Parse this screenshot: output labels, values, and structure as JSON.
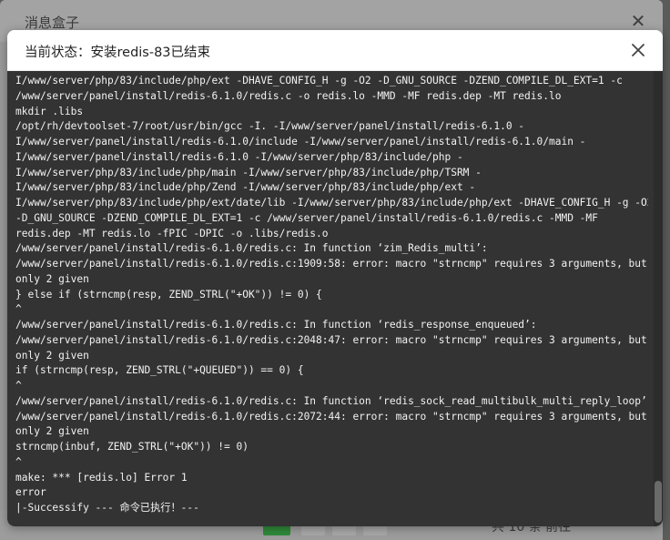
{
  "background_window": {
    "title": "消息盒子",
    "pagination": {
      "partial_text_right": "共 10 条 前往"
    }
  },
  "dialog": {
    "title": "当前状态：安装redis-83已结束",
    "close_icon": "close-icon"
  },
  "console": {
    "lines": [
      "I/www/server/php/83/include/php/ext -DHAVE_CONFIG_H -g -O2 -D_GNU_SOURCE -DZEND_COMPILE_DL_EXT=1 -c",
      "/www/server/panel/install/redis-6.1.0/redis.c -o redis.lo -MMD -MF redis.dep -MT redis.lo",
      "mkdir .libs",
      "/opt/rh/devtoolset-7/root/usr/bin/gcc -I. -I/www/server/panel/install/redis-6.1.0 -",
      "I/www/server/panel/install/redis-6.1.0/include -I/www/server/panel/install/redis-6.1.0/main -",
      "I/www/server/panel/install/redis-6.1.0 -I/www/server/php/83/include/php -",
      "I/www/server/php/83/include/php/main -I/www/server/php/83/include/php/TSRM -",
      "I/www/server/php/83/include/php/Zend -I/www/server/php/83/include/php/ext -",
      "I/www/server/php/83/include/php/ext/date/lib -I/www/server/php/83/include/php/ext -DHAVE_CONFIG_H -g -O2",
      "-D_GNU_SOURCE -DZEND_COMPILE_DL_EXT=1 -c /www/server/panel/install/redis-6.1.0/redis.c -MMD -MF",
      "redis.dep -MT redis.lo -fPIC -DPIC -o .libs/redis.o",
      "/www/server/panel/install/redis-6.1.0/redis.c: In function ‘zim_Redis_multi’:",
      "/www/server/panel/install/redis-6.1.0/redis.c:1909:58: error: macro \"strncmp\" requires 3 arguments, but",
      "only 2 given",
      "} else if (strncmp(resp, ZEND_STRL(\"+OK\")) != 0) {",
      "^",
      "/www/server/panel/install/redis-6.1.0/redis.c: In function ‘redis_response_enqueued’:",
      "/www/server/panel/install/redis-6.1.0/redis.c:2048:47: error: macro \"strncmp\" requires 3 arguments, but",
      "only 2 given",
      "if (strncmp(resp, ZEND_STRL(\"+QUEUED\")) == 0) {",
      "^",
      "/www/server/panel/install/redis-6.1.0/redis.c: In function ‘redis_sock_read_multibulk_multi_reply_loop’:",
      "/www/server/panel/install/redis-6.1.0/redis.c:2072:44: error: macro \"strncmp\" requires 3 arguments, but",
      "only 2 given",
      "strncmp(inbuf, ZEND_STRL(\"+OK\")) != 0)",
      "^",
      "make: *** [redis.lo] Error 1",
      "error",
      "|-Successify --- 命令已执行！---"
    ]
  },
  "colors": {
    "console_bg": "#333333",
    "console_text": "#f2f2f2",
    "overlay": "#5b5b5b",
    "accent_green": "#2f8a3a"
  }
}
